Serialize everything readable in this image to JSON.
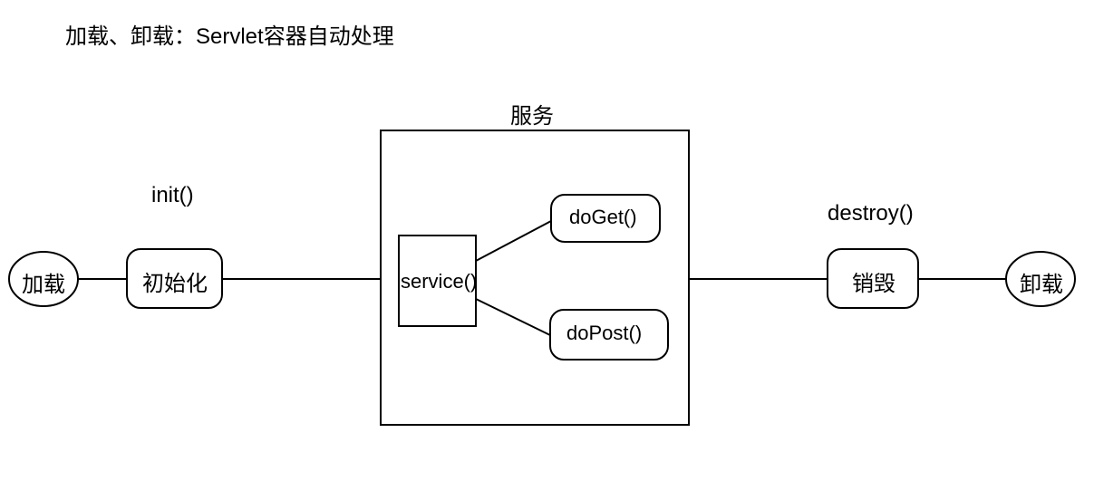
{
  "title": "加载、卸载：Servlet容器自动处理",
  "nodes": {
    "load": "加载",
    "init": "初始化",
    "init_label": "init()",
    "service_title": "服务",
    "service": "service()",
    "doGet": "doGet()",
    "doPost": "doPost()",
    "destroy": "销毁",
    "destroy_label": "destroy()",
    "unload": "卸载"
  }
}
